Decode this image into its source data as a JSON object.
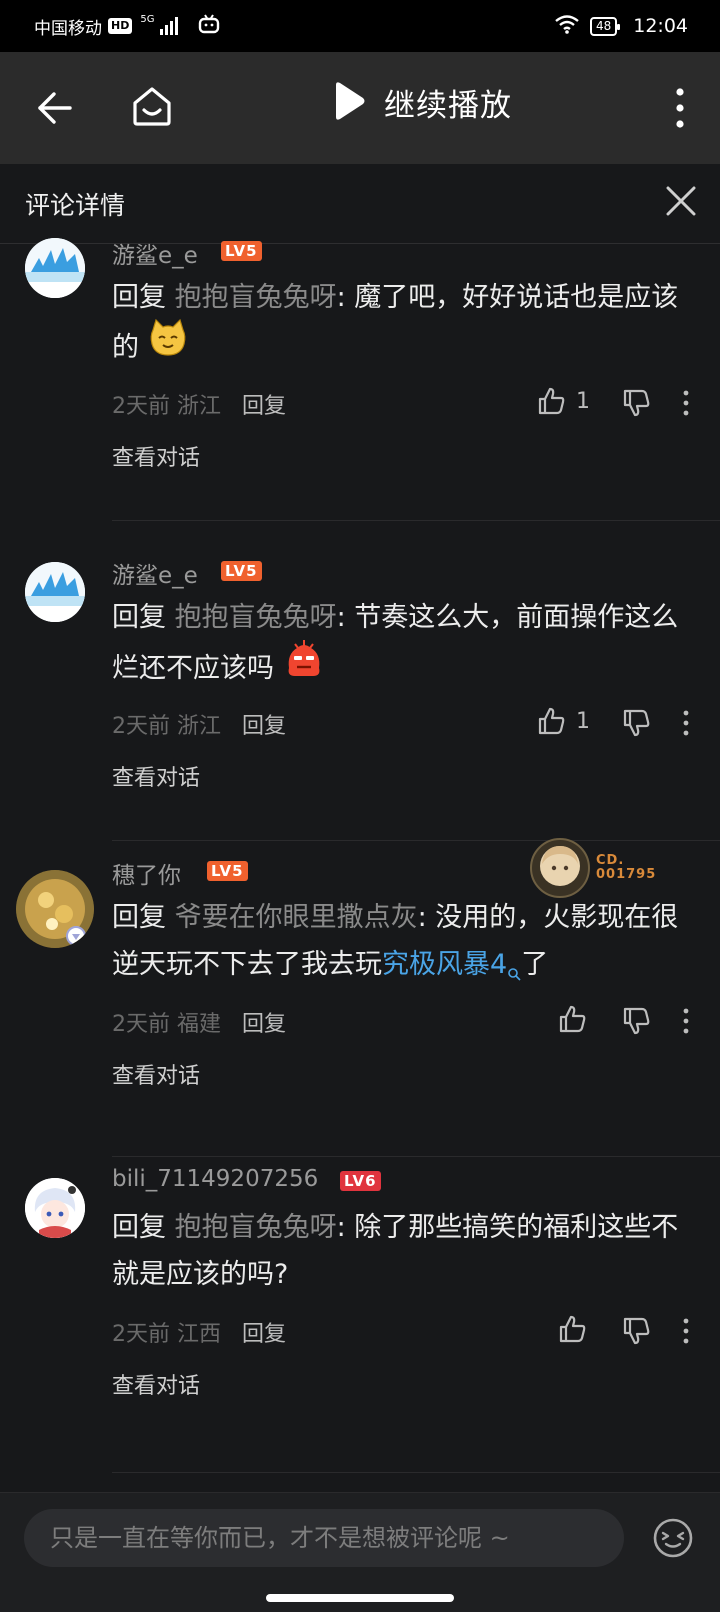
{
  "status_bar": {
    "carrier": "中国移动",
    "hd": "HD",
    "network": "5G",
    "battery": "48",
    "time": "12:04"
  },
  "nav": {
    "continue_label": "继续播放"
  },
  "detail": {
    "title": "评论详情"
  },
  "comments": [
    {
      "username": "游鲨e_e",
      "level": "LV5",
      "reply_prefix": "回复",
      "reply_target": "抱抱盲兔兔呀",
      "text": ": 魔了吧，好好说话也是应该的",
      "time": "2天前",
      "location": "浙江",
      "reply_label": "回复",
      "likes": "1",
      "view_conversation": "查看对话"
    },
    {
      "username": "游鲨e_e",
      "level": "LV5",
      "reply_prefix": "回复",
      "reply_target": "抱抱盲兔兔呀",
      "text": ": 节奏这么大，前面操作这么烂还不应该吗",
      "time": "2天前",
      "location": "浙江",
      "reply_label": "回复",
      "likes": "1",
      "view_conversation": "查看对话"
    },
    {
      "username": "穗了你",
      "level": "LV5",
      "badge_text_line1": "CD.",
      "badge_text_line2": "001795",
      "reply_prefix": "回复",
      "reply_target": "爷要在你眼里撒点灰",
      "text_before": ": 没用的，火影现在很逆天玩不下去了我去玩",
      "link_keyword": "究极风暴4",
      "text_after": "了",
      "time": "2天前",
      "location": "福建",
      "reply_label": "回复",
      "view_conversation": "查看对话"
    },
    {
      "username": "bili_71149207256",
      "level": "LV6",
      "reply_prefix": "回复",
      "reply_target": "抱抱盲兔兔呀",
      "text": ": 除了那些搞笑的福利这些不就是应该的吗?",
      "time": "2天前",
      "location": "江西",
      "reply_label": "回复",
      "view_conversation": "查看对话"
    }
  ],
  "input": {
    "placeholder": "只是一直在等你而已，才不是想被评论呢 ~"
  },
  "colors": {
    "background": "#17181a",
    "nav_bg": "#2b2b2b",
    "level5": "#f0612e",
    "level6": "#e0343e",
    "link": "#4aa4e6"
  }
}
